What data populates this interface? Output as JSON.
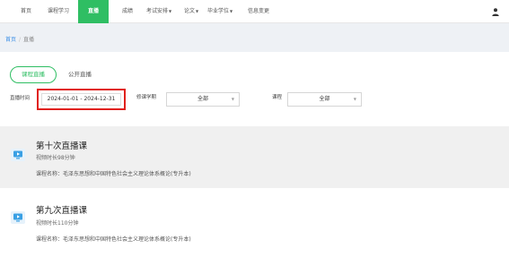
{
  "nav": {
    "items": [
      {
        "label": "首页"
      },
      {
        "label": "课程学习"
      },
      {
        "label": "直播"
      },
      {
        "label": "成绩"
      },
      {
        "label": "考试安排"
      },
      {
        "label": "论文"
      },
      {
        "label": "毕业学位"
      },
      {
        "label": "信息变更"
      }
    ],
    "active_color": "#2fbe63"
  },
  "breadcrumb": {
    "home": "首页",
    "separator": "/",
    "current": "直播"
  },
  "tabs": {
    "live": "课程直播",
    "public": "公开直播"
  },
  "filters": {
    "time_label": "直播时间",
    "date_range": "2024-01-01 - 2024-12-31",
    "term_label": "修课学期",
    "term_value": "全部",
    "course_label": "课程",
    "course_value": "全部"
  },
  "cards": [
    {
      "title": "第十次直播课",
      "duration": "视频时长98分钟",
      "course": "课程名称：毛泽东思想和中国特色社会主义理论体系概论(专升本)"
    },
    {
      "title": "第九次直播课",
      "duration": "视频时长110分钟",
      "course": "课程名称：毛泽东思想和中国特色社会主义理论体系概论(专升本)"
    }
  ],
  "colors": {
    "accent": "#2fbe63",
    "highlight_border": "#e0201b",
    "link": "#3a8ee6"
  },
  "icons": {
    "user": "user-icon",
    "video": "video-icon",
    "dropdown": "chevron-down-icon"
  }
}
